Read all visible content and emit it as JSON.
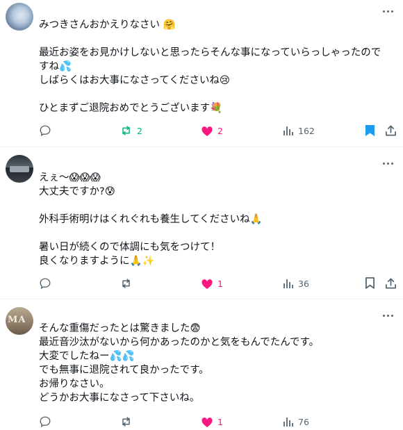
{
  "replies": [
    {
      "text": "みつきさんおかえりなさい 🤗\n\n最近お姿をお見かけしないと思ったらそんな事になっていらっしゃったのですね💦\nしばらくはお大事になさってくださいね😢\n\nひとまずご退院おめでとうございます💐",
      "reposts": "2",
      "likes": "2",
      "views": "162",
      "bookmarked": true,
      "reposted": true,
      "liked": true
    },
    {
      "text": "えぇ〜😱😱😱\n大丈夫ですか?😰\n\n外科手術明けはくれぐれも養生してくださいね🙏\n\n暑い日が続くので体調にも気をつけて！\n良くなりますように🙏✨",
      "reposts": "",
      "likes": "1",
      "views": "36",
      "bookmarked": false,
      "reposted": false,
      "liked": true
    },
    {
      "text": "そんな重傷だったとは驚きました😨\n最近音沙汰がないから何かあったのかと気をもんでたんです。\n大変でしたねー💦💦\nでも無事に退院されて良かったです。\nお帰りなさい。\nどうかお大事になさって下さいね。",
      "avatar_text": "MA",
      "reposts": "",
      "likes": "1",
      "views": "76",
      "bookmarked": false,
      "reposted": false,
      "liked": true
    }
  ],
  "colors": {
    "repost": "#00ba7c",
    "like": "#f91880",
    "bookmark": "#1d9bf0",
    "muted": "#536471"
  },
  "icons": [
    "reply-icon",
    "repost-icon",
    "like-icon",
    "views-icon",
    "bookmark-icon",
    "share-icon",
    "more-icon"
  ]
}
